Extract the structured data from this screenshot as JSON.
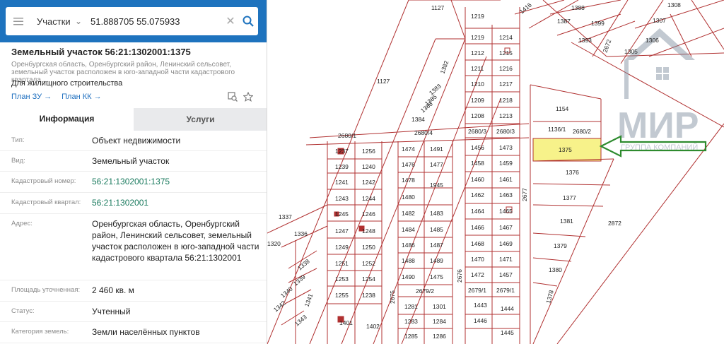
{
  "search": {
    "type": "Участки",
    "value": "51.888705 55.075933"
  },
  "object": {
    "title": "Земельный участок 56:21:1302001:1375",
    "address_short": "Оренбургская область, Оренбургский район, Ленинский сельсовет, земельный участок расположен в юго-западной части кадастрового квартала ...",
    "purpose": "Для жилищного строительства",
    "plan_zu": "План ЗУ →",
    "plan_kk": "План КК →"
  },
  "tabs": {
    "info": "Информация",
    "services": "Услуги"
  },
  "info": [
    {
      "label": "Тип:",
      "value": "Объект недвижимости"
    },
    {
      "label": "Вид:",
      "value": "Земельный участок"
    },
    {
      "label": "Кадастровый номер:",
      "value": "56:21:1302001:1375"
    },
    {
      "label": "Кадастровый квартал:",
      "value": "56:21:1302001"
    },
    {
      "label": "Адрес:",
      "value": "Оренбургская область, Оренбургский район, Ленинский сельсовет, земельный участок расположен в юго-западной части кадастрового квартала 56:21:1302001"
    },
    {
      "label": "Площадь уточненная:",
      "value": "2 460 кв. м"
    },
    {
      "label": "Статус:",
      "value": "Учтенный"
    },
    {
      "label": "Категория земель:",
      "value": "Земли населённых пунктов"
    }
  ],
  "map": {
    "highlight_color": "#f7f28a",
    "line_color": "#c0392b",
    "arrow_color": "#2e8b2e",
    "logo_text": "МИР",
    "logo_sub": "ГРУППА КОМПАНИЙ",
    "labels": {
      "l1127a": "1127",
      "l1127b": "1127",
      "l1219": "1219",
      "l1219b": "1219",
      "l1214": "1214",
      "l1212": "1212",
      "l1215": "1215",
      "l1211": "1211",
      "l1216": "1216",
      "l1210": "1210",
      "l1217": "1217",
      "l1209": "1209",
      "l1218": "1218",
      "l1208": "1208",
      "l1213": "1213",
      "l1154": "1154",
      "l1136": "1136/1",
      "l2680_2": "2680/2",
      "l2680_3a": "2680/3",
      "l2680_3b": "2680/3",
      "l2680_4": "2680/4",
      "l2680_1": "2680/1",
      "l1382": "1382",
      "l1383": "1383",
      "l1384": "1384",
      "l1385": "1385",
      "l1386": "1386",
      "l1237": "1237",
      "l1256": "1256",
      "l1474": "1474",
      "l1491": "1491",
      "l1456": "1456",
      "l1473": "1473",
      "l1375": "1375",
      "l1239": "1239",
      "l1240": "1240",
      "l1476": "1476",
      "l1477": "1477",
      "l1458": "1458",
      "l1459": "1459",
      "l1376": "1376",
      "l1241": "1241",
      "l1242": "1242",
      "l1478": "1478",
      "l1945": "1945",
      "l1460": "1460",
      "l1461": "1461",
      "l1377": "1377",
      "l1243": "1243",
      "l1244": "1244",
      "l1480": "1480",
      "l1462": "1462",
      "l1463": "1463",
      "l1245": "1245",
      "l1246": "1246",
      "l1482": "1482",
      "l1483": "1483",
      "l1464": "1464",
      "l1465": "1465",
      "l1381": "1381",
      "l1247": "1247",
      "l1248": "1248",
      "l1484": "1484",
      "l1485": "1485",
      "l1466": "1466",
      "l1467": "1467",
      "l1249": "1249",
      "l1250": "1250",
      "l1486": "1486",
      "l1487": "1487",
      "l1468": "1468",
      "l1469": "1469",
      "l1379": "1379",
      "l1251": "1251",
      "l1252": "1252",
      "l1488": "1488",
      "l1489": "1489",
      "l1470": "1470",
      "l1471": "1471",
      "l1380": "1380",
      "l1253": "1253",
      "l1254": "1254",
      "l1490": "1490",
      "l1475": "1475",
      "l1472": "1472",
      "l1457": "1457",
      "l1255": "1255",
      "l1238": "1238",
      "l2679_2": "2679/2",
      "l2679_1a": "2679/1",
      "l2679_1b": "2679/1",
      "l1281": "1281",
      "l1301": "1301",
      "l1443": "1443",
      "l1444": "1444",
      "l1401": "1401",
      "l1402": "1402",
      "l1283": "1283",
      "l1284": "1284",
      "l1446": "1446",
      "l1285": "1285",
      "l1286": "1286",
      "l1445": "1445",
      "l2677": "2677",
      "l2676": "2676",
      "l2675": "2675",
      "l2872": "2872",
      "l1378": "1378",
      "l1337": "1337",
      "l1336": "1336",
      "l1320": "1320",
      "l1338": "1338",
      "l1339": "1339",
      "l1340": "1340",
      "l1341": "1341",
      "l1342": "1342",
      "l1343": "1343",
      "l1416": "1416",
      "l1388": "1388",
      "l1387": "1387",
      "l1399": "1399",
      "l1393": "1393",
      "l2672": "2672",
      "l1305": "1305",
      "l1306": "1306",
      "l1307": "1307",
      "l1308": "1308"
    }
  }
}
